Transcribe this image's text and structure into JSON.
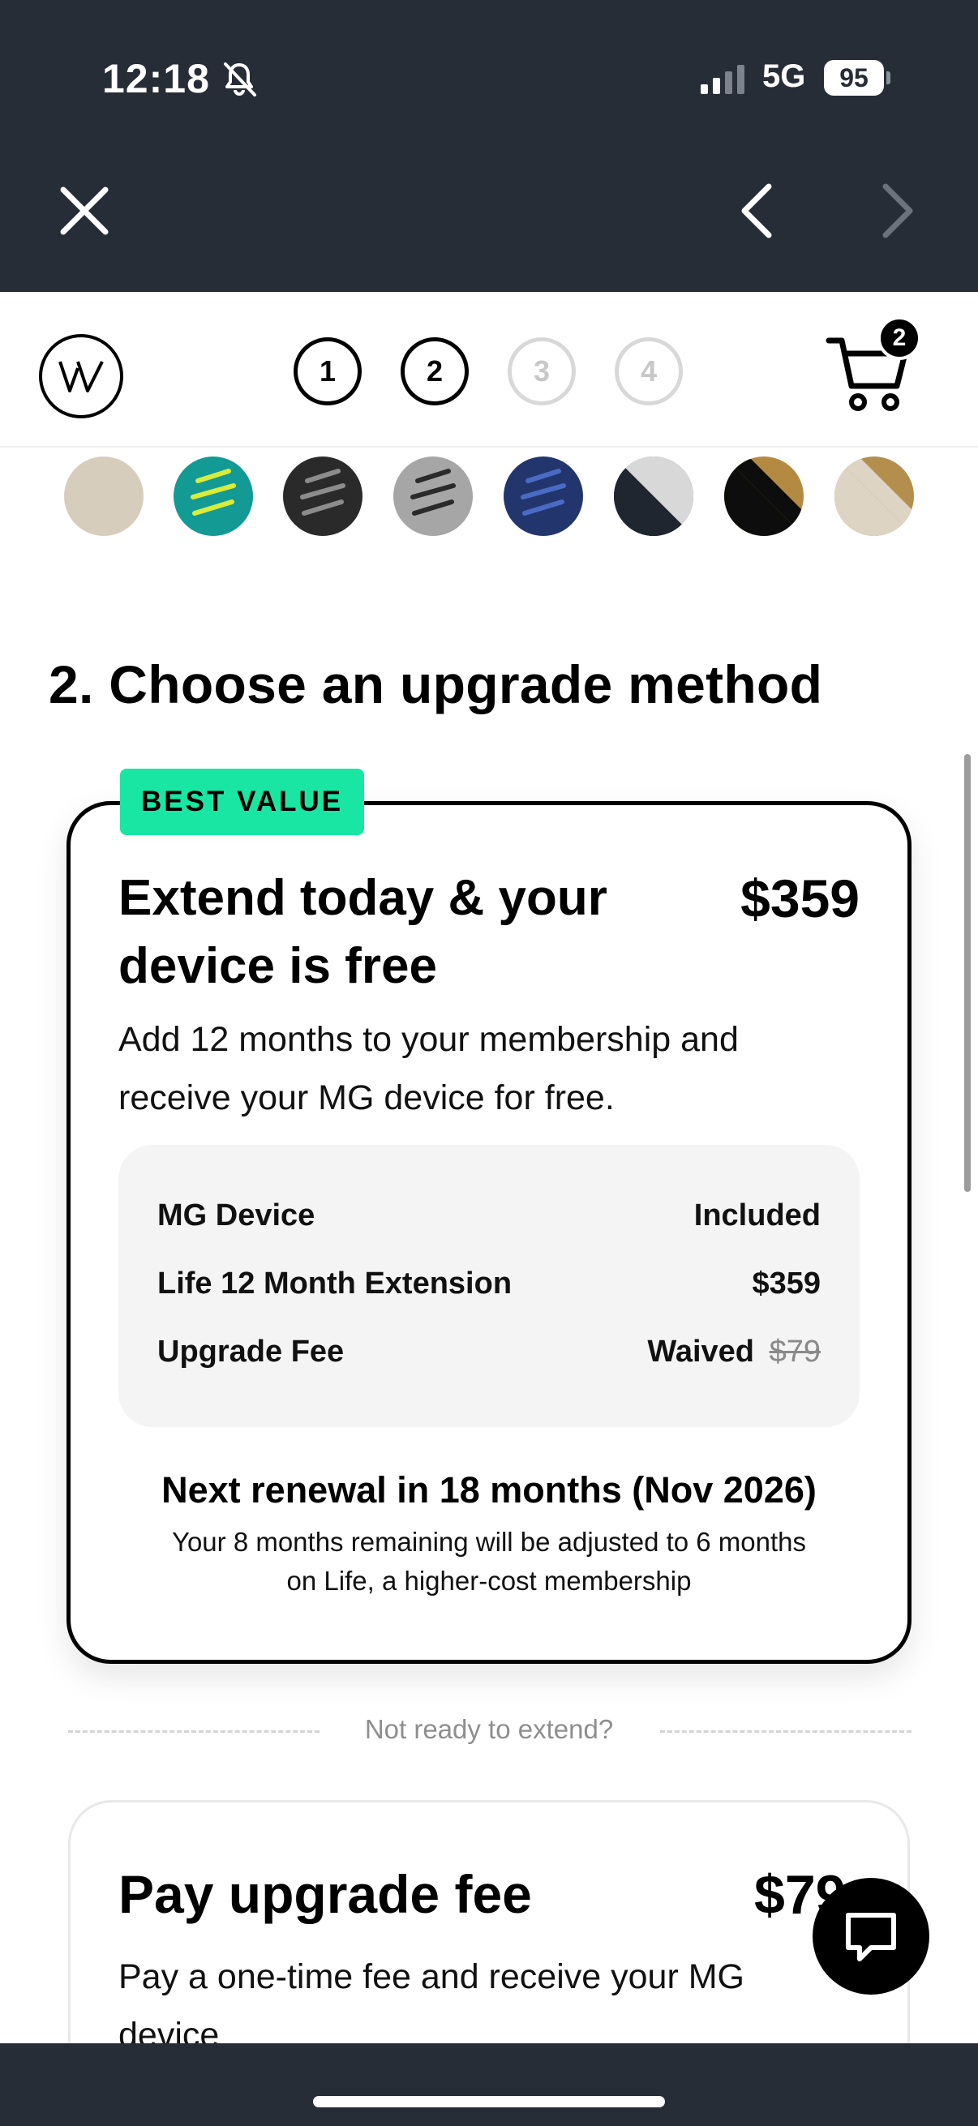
{
  "status_bar": {
    "time": "12:18",
    "network": "5G",
    "battery": "95",
    "icons": [
      "bell-slash-icon",
      "signal-bars-icon",
      "battery-icon"
    ]
  },
  "browser_chrome": {
    "close_icon": "close-icon",
    "back_icon": "chevron-left-icon",
    "forward_icon": "chevron-right-icon"
  },
  "header": {
    "logo_icon": "whoop-logo-icon",
    "steps": [
      {
        "label": "1",
        "active": true
      },
      {
        "label": "2",
        "active": true
      },
      {
        "label": "3",
        "active": false
      },
      {
        "label": "4",
        "active": false
      }
    ],
    "cart_icon": "cart-icon",
    "cart_count": "2"
  },
  "swatches": [
    {
      "name": "sand",
      "colors": [
        "#d7cdbd"
      ]
    },
    {
      "name": "teal-lime",
      "colors": [
        "#149a94",
        "#d9ec3a"
      ]
    },
    {
      "name": "black-stripes",
      "colors": [
        "#2a2a2a",
        "#8c8c8c"
      ]
    },
    {
      "name": "grey-stripes",
      "colors": [
        "#a6a6a6",
        "#2a2a2a"
      ]
    },
    {
      "name": "blue-stripes",
      "colors": [
        "#23356d",
        "#3f5db0"
      ]
    },
    {
      "name": "black-silver",
      "colors": [
        "#1f2630",
        "#d8d8d8"
      ]
    },
    {
      "name": "black-gold",
      "colors": [
        "#0d0d0d",
        "#b48a42"
      ]
    },
    {
      "name": "sand-gold",
      "colors": [
        "#ddd4c4",
        "#b48e4c"
      ]
    }
  ],
  "section": {
    "title": "2. Choose an upgrade method"
  },
  "best_value_card": {
    "badge": "BEST VALUE",
    "title": "Extend today & your device is free",
    "price": "$359",
    "description": "Add 12 months to your membership and receive your MG device for free.",
    "rows": [
      {
        "label": "MG Device",
        "value": "Included",
        "strike": ""
      },
      {
        "label": "Life 12 Month Extension",
        "value": "$359",
        "strike": ""
      },
      {
        "label": "Upgrade Fee",
        "value": "Waived",
        "strike": "$79"
      }
    ],
    "renewal_title": "Next renewal in 18 months (Nov 2026)",
    "renewal_note": "Your 8 months remaining will be adjusted to 6 months on Life, a higher-cost membership"
  },
  "divider": {
    "text": "Not ready to extend?"
  },
  "pay_fee_card": {
    "title": "Pay upgrade fee",
    "price": "$79",
    "description": "Pay a one-time fee and receive your MG device"
  },
  "chat": {
    "icon": "chat-bubble-icon"
  },
  "colors": {
    "chrome": "#262d36",
    "badge": "#19e6a2",
    "summary_bg": "#f4f4f4",
    "muted": "#8e8e8e"
  }
}
